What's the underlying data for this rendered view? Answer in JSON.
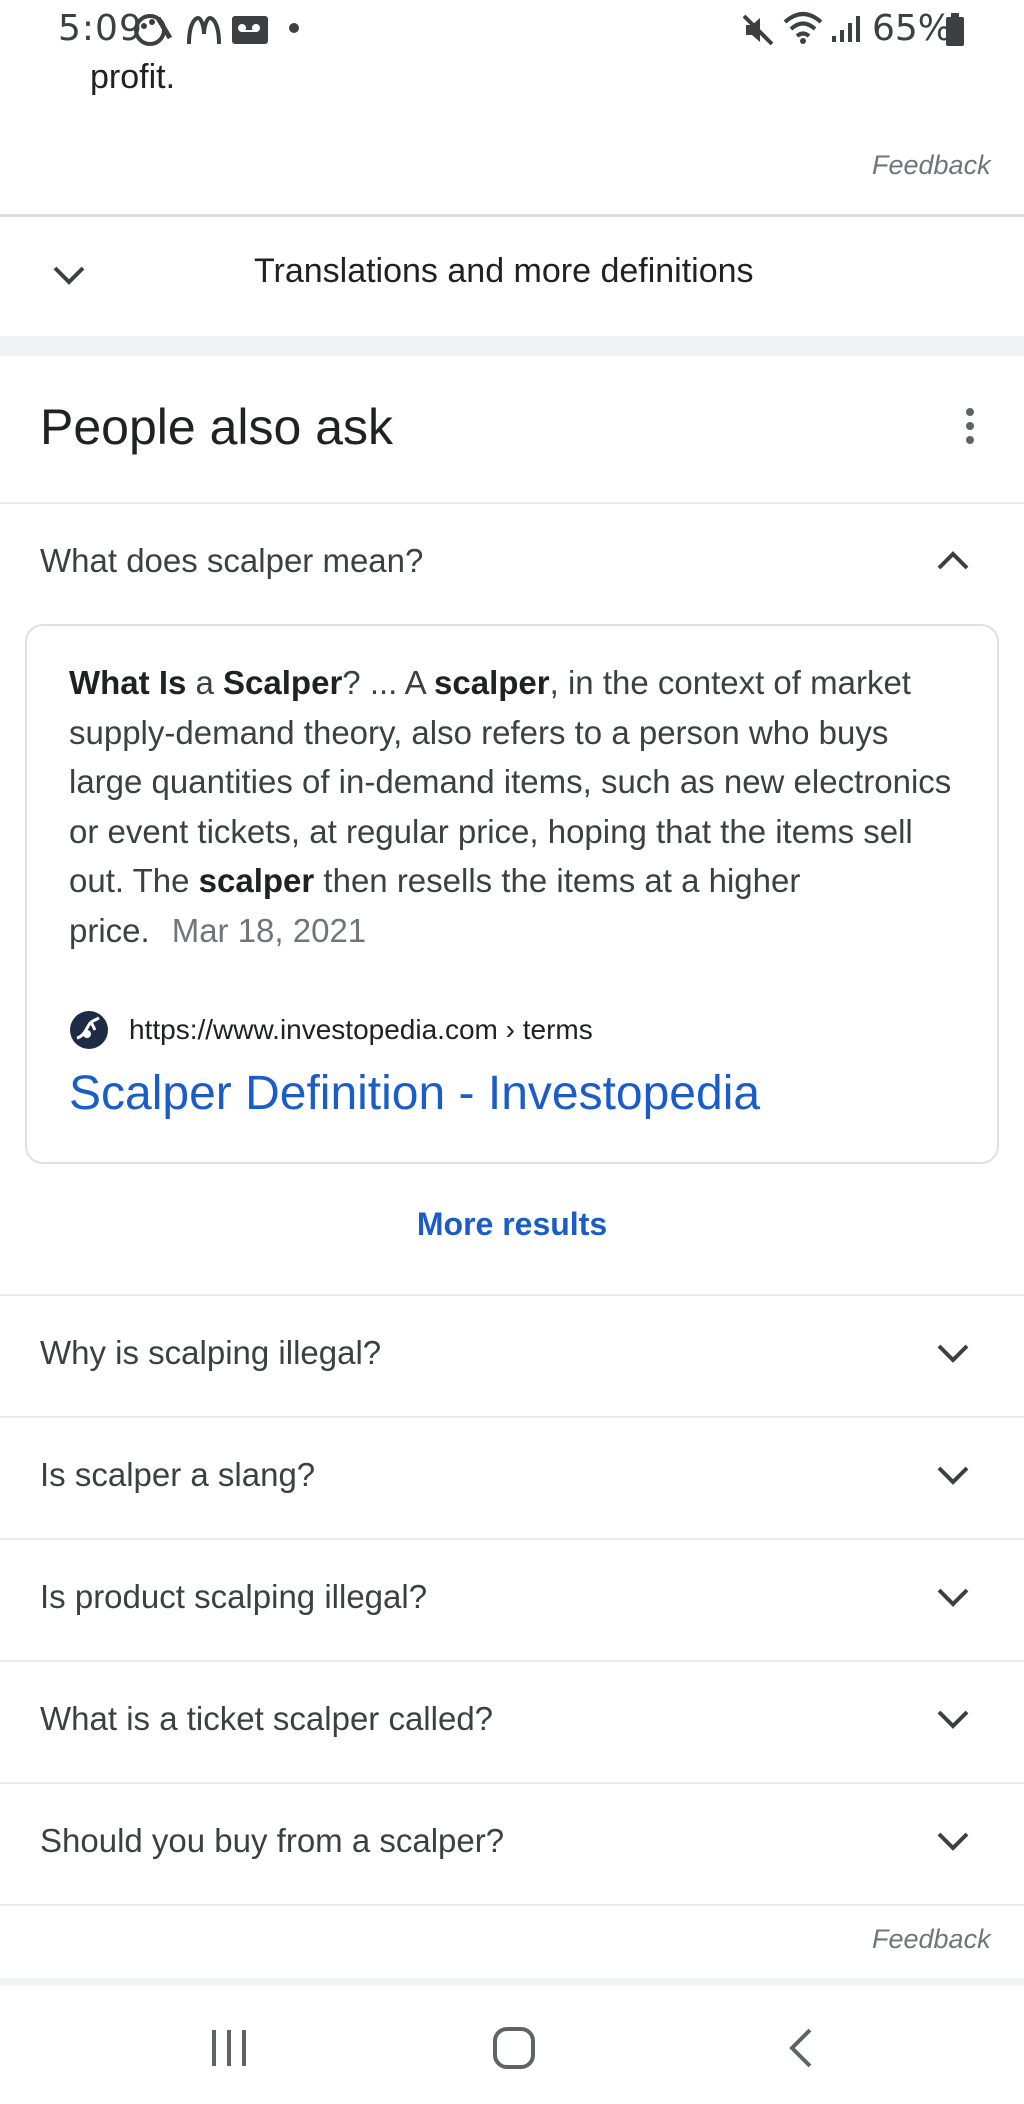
{
  "status_bar": {
    "time": "5:09",
    "battery": "65%"
  },
  "definition": {
    "tail_text": "profit.",
    "feedback": "Feedback",
    "translations_label": "Translations and more definitions"
  },
  "people_also_ask": {
    "title": "People also ask",
    "expanded": {
      "question": "What does scalper mean?",
      "answer_parts": {
        "p1": "What Is",
        "p2": " a ",
        "p3": "Scalper",
        "p4": "? ... A ",
        "p5": "scalper",
        "p6": ", in the context of market supply-demand theory, also refers to a person who buys large quantities of in-demand items, such as new electronics or event tickets, at regular price, hoping that the items sell out. The ",
        "p7": "scalper",
        "p8": " then resells the items at a higher price."
      },
      "date": "Mar 18, 2021",
      "source_url": "https://www.investopedia.com › terms",
      "source_title": "Scalper Definition - Investopedia"
    },
    "more_results": "More results",
    "questions": [
      "Why is scalping illegal?",
      "Is scalper a slang?",
      "Is product scalping illegal?",
      "What is a ticket scalper called?",
      "Should you buy from a scalper?"
    ],
    "feedback": "Feedback"
  },
  "colors": {
    "link": "#1a5dc8",
    "text": "#202124",
    "muted": "#70757a"
  }
}
